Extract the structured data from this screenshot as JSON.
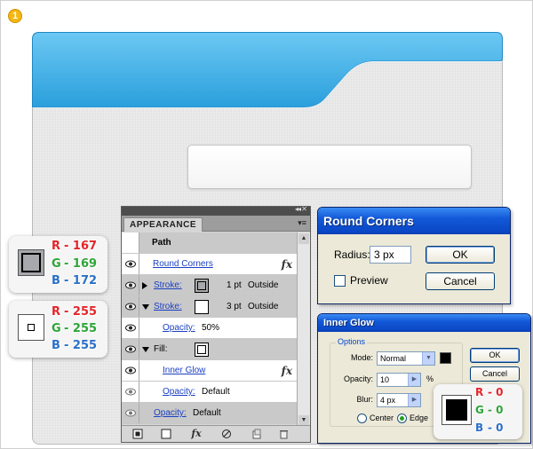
{
  "step_number": "1",
  "colors": {
    "folder_blue": "#3fb1e9",
    "card_1": {
      "R": "R",
      "r": "167",
      "G": "G",
      "g": "169",
      "B": "B",
      "b": "172"
    },
    "card_2": {
      "R": "R",
      "r": "255",
      "G": "G",
      "g": "255",
      "B": "B",
      "b": "255"
    },
    "card_3": {
      "R": "R",
      "r": "0",
      "G": "G",
      "g": "0",
      "B": "B",
      "b": "0"
    }
  },
  "appearance": {
    "tab_label": "APPEARANCE",
    "topbar_arrows": "◂◂ ✕",
    "menu_icon": "▾≡",
    "path_label": "Path",
    "round_corners": "Round Corners",
    "stroke1_label": "Stroke:",
    "stroke1_weight": "1 pt",
    "stroke1_align": "Outside",
    "stroke2_label": "Stroke:",
    "stroke2_weight": "3 pt",
    "stroke2_align": "Outside",
    "opacity_label": "Opacity:",
    "opacity_value": "50%",
    "fill_label": "Fill:",
    "inner_glow": "Inner Glow",
    "opacity2_label": "Opacity:",
    "opacity2_value": "Default",
    "opacity3_label": "Opacity:",
    "opacity3_value": "Default",
    "fx_symbol": "fx",
    "bottom_fx": "fx"
  },
  "round_corners_dialog": {
    "title": "Round Corners",
    "radius_label": "Radius:",
    "radius_value": "3 px",
    "preview_label": "Preview",
    "ok": "OK",
    "cancel": "Cancel"
  },
  "inner_glow_dialog": {
    "title": "Inner Glow",
    "group_label": "Options",
    "mode_label": "Mode:",
    "mode_value": "Normal",
    "opacity_label": "Opacity:",
    "opacity_value": "10",
    "opacity_unit": "%",
    "blur_label": "Blur:",
    "blur_value": "4 px",
    "center_label": "Center",
    "edge_label": "Edge",
    "ok": "OK",
    "cancel": "Cancel",
    "glow_color": "#000000"
  }
}
